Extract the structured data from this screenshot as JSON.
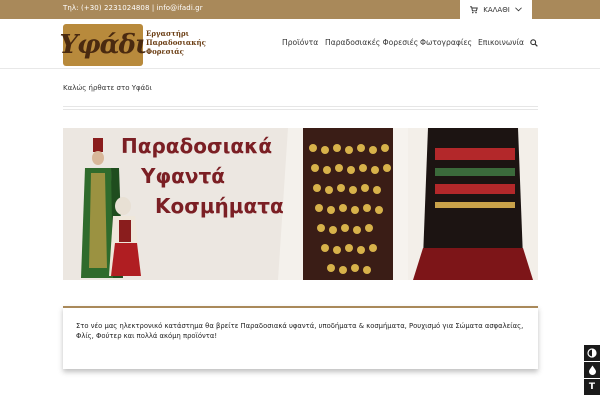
{
  "topbar": {
    "contact": "Τηλ: (+30) 2231024808 | info@ifadi.gr",
    "cart_label": "ΚΑΛΑΘΙ"
  },
  "logo": {
    "word": "Υφάδι",
    "subtitle": "Εργαστήρι Παραδοσιακής Φορεσιάς"
  },
  "nav": {
    "items": [
      "Προϊόντα",
      "Παραδοσιακές Φορεσιές",
      "Φωτογραφίες",
      "Επικοινωνία"
    ]
  },
  "welcome": "Καλώς ήρθατε στο Υφάδι",
  "banner": {
    "line1": "Παραδοσιακά",
    "line2": "Υφαντά",
    "line3": "Κοσμήματα"
  },
  "info": {
    "text": "Στο νέο μας ηλεκτρονικό κατάστημα θα βρείτε Παραδοσιακά υφαντά, υποδήματα & κοσμήματα, Ρουχισμό για Σώματα ασφαλείας, Φλίς, Φούτερ και πολλά ακόμη προϊόντα!"
  },
  "accessibility": {
    "text_size_label": "T"
  },
  "colors": {
    "brand": "#a9895a",
    "banner_text": "#7b1f24"
  }
}
